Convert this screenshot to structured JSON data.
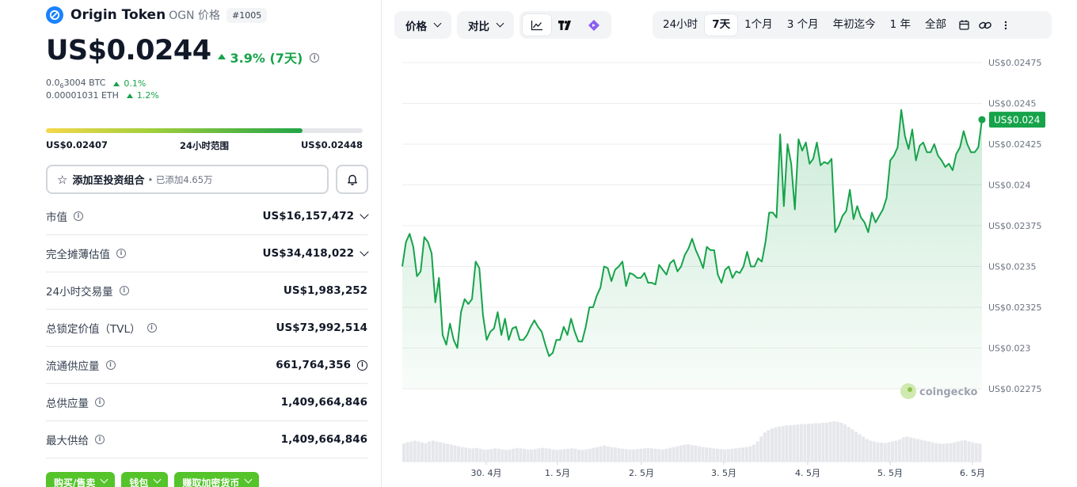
{
  "coin": {
    "name": "Origin Token",
    "symbol_label": "OGN 价格",
    "rank": "#1005",
    "price": "US$0.0244",
    "change": "3.9% (7天)",
    "btc_price_prefix": "0.0",
    "btc_price_sub": "6",
    "btc_price_suffix": "3004 BTC",
    "btc_change": "0.1%",
    "eth_price": "0.00001031 ETH",
    "eth_change": "1.2%"
  },
  "range_24h": {
    "low": "US$0.02407",
    "label": "24小时范围",
    "high": "US$0.02448",
    "position": 0.81
  },
  "portfolio": {
    "button_label": "添加至投资组合",
    "added_text": "• 已添加4.65万"
  },
  "stats": [
    {
      "label": "市值",
      "value": "US$16,157,472",
      "chevron": true,
      "value_info": false
    },
    {
      "label": "完全摊薄估值",
      "value": "US$34,418,022",
      "chevron": true,
      "value_info": false
    },
    {
      "label": "24小时交易量",
      "value": "US$1,983,252",
      "chevron": false,
      "value_info": false
    },
    {
      "label": "总锁定价值（TVL）",
      "value": "US$73,992,514",
      "chevron": false,
      "value_info": false
    },
    {
      "label": "流通供应量",
      "value": "661,764,356",
      "chevron": false,
      "value_info": true
    },
    {
      "label": "总供应量",
      "value": "1,409,664,846",
      "chevron": false,
      "value_info": false
    },
    {
      "label": "最大供给",
      "value": "1,409,664,846",
      "chevron": false,
      "value_info": false
    }
  ],
  "actions": {
    "buy_sell": "购买/售卖",
    "wallet": "钱包",
    "earn": "赚取加密货币"
  },
  "toolbar": {
    "price_dropdown": "价格",
    "compare_dropdown": "对比",
    "ranges": [
      "24小时",
      "7天",
      "1个月",
      "3 个月",
      "年初迄今",
      "1 年",
      "全部"
    ],
    "active_range": "7天"
  },
  "colors": {
    "up_green": "#16a34a",
    "line_green": "#16a34a",
    "brand_blue": "#1a82ff"
  },
  "chart_data": {
    "type": "area",
    "y_tick_labels": [
      "US$0.02475",
      "US$0.0245",
      "US$0.02425",
      "US$0.024",
      "US$0.02375",
      "US$0.0235",
      "US$0.02325",
      "US$0.023",
      "US$0.02275"
    ],
    "y_ticks": [
      0.02475,
      0.0245,
      0.02425,
      0.024,
      0.02375,
      0.0235,
      0.02325,
      0.023,
      0.02275
    ],
    "ylim": [
      0.02275,
      0.02475
    ],
    "x_tick_labels": [
      "30. 4月",
      "1. 5月",
      "2. 5月",
      "3. 5月",
      "4. 5月",
      "5. 5月",
      "6. 5月"
    ],
    "current_label": "US$0.024",
    "watermark": "coingecko",
    "values": [
      0.0235,
      0.02365,
      0.0237,
      0.02362,
      0.02344,
      0.02347,
      0.02368,
      0.02365,
      0.02358,
      0.02328,
      0.02343,
      0.02308,
      0.02302,
      0.02315,
      0.02305,
      0.023,
      0.02322,
      0.0233,
      0.02327,
      0.0233,
      0.02353,
      0.02349,
      0.0232,
      0.02305,
      0.0231,
      0.02312,
      0.02322,
      0.02308,
      0.02318,
      0.02305,
      0.02312,
      0.02313,
      0.02305,
      0.02305,
      0.02308,
      0.02313,
      0.02317,
      0.02313,
      0.0231,
      0.02302,
      0.02295,
      0.02297,
      0.02305,
      0.02305,
      0.02313,
      0.02308,
      0.02318,
      0.0231,
      0.02304,
      0.02304,
      0.02313,
      0.02325,
      0.02325,
      0.02332,
      0.02337,
      0.0235,
      0.02349,
      0.02341,
      0.02348,
      0.0235,
      0.02353,
      0.02338,
      0.02346,
      0.02345,
      0.02343,
      0.02343,
      0.02346,
      0.0234,
      0.0234,
      0.02339,
      0.02351,
      0.02348,
      0.02345,
      0.02352,
      0.02354,
      0.02347,
      0.0235,
      0.02357,
      0.02361,
      0.02367,
      0.0236,
      0.02355,
      0.02349,
      0.02362,
      0.0236,
      0.0236,
      0.02345,
      0.0234,
      0.02348,
      0.0235,
      0.02343,
      0.02347,
      0.02346,
      0.0235,
      0.02359,
      0.0235,
      0.0235,
      0.02355,
      0.02353,
      0.02365,
      0.02383,
      0.02383,
      0.0238,
      0.02431,
      0.02387,
      0.02425,
      0.02413,
      0.02385,
      0.02428,
      0.02421,
      0.02426,
      0.02413,
      0.02416,
      0.02426,
      0.02412,
      0.02414,
      0.02413,
      0.02416,
      0.02371,
      0.02375,
      0.02381,
      0.02384,
      0.02397,
      0.02379,
      0.02387,
      0.0238,
      0.02377,
      0.02371,
      0.02383,
      0.02377,
      0.02381,
      0.02385,
      0.02392,
      0.02415,
      0.02418,
      0.02423,
      0.02446,
      0.0243,
      0.02422,
      0.02434,
      0.02415,
      0.02424,
      0.02426,
      0.0242,
      0.0242,
      0.02425,
      0.02418,
      0.02415,
      0.02411,
      0.02413,
      0.02409,
      0.02419,
      0.02423,
      0.02433,
      0.02425,
      0.0242,
      0.0242,
      0.02423,
      0.0244
    ],
    "volume": [
      0.45,
      0.48,
      0.5,
      0.52,
      0.5,
      0.47,
      0.46,
      0.5,
      0.52,
      0.5,
      0.48,
      0.46,
      0.44,
      0.42,
      0.4,
      0.38,
      0.36,
      0.35,
      0.33,
      0.33,
      0.34,
      0.32,
      0.3,
      0.3,
      0.31,
      0.33,
      0.32,
      0.3,
      0.29,
      0.3,
      0.32,
      0.34,
      0.33,
      0.32,
      0.3,
      0.3,
      0.31,
      0.33,
      0.34,
      0.33,
      0.32,
      0.3,
      0.29,
      0.3,
      0.31,
      0.32,
      0.33,
      0.32,
      0.3,
      0.29,
      0.3,
      0.32,
      0.34,
      0.36,
      0.38,
      0.4,
      0.38,
      0.36,
      0.35,
      0.33,
      0.32,
      0.31,
      0.3,
      0.3,
      0.31,
      0.32,
      0.33,
      0.34,
      0.33,
      0.32,
      0.31,
      0.3,
      0.32,
      0.34,
      0.36,
      0.38,
      0.4,
      0.42,
      0.43,
      0.41,
      0.4,
      0.38,
      0.36,
      0.35,
      0.34,
      0.33,
      0.32,
      0.31,
      0.3,
      0.31,
      0.32,
      0.33,
      0.34,
      0.35,
      0.36,
      0.38,
      0.42,
      0.5,
      0.62,
      0.72,
      0.78,
      0.82,
      0.85,
      0.87,
      0.88,
      0.9,
      0.9,
      0.91,
      0.92,
      0.93,
      0.93,
      0.94,
      0.94,
      0.95,
      0.95,
      0.96,
      0.97,
      0.98,
      1.0,
      0.99,
      0.96,
      0.92,
      0.86,
      0.8,
      0.74,
      0.68,
      0.62,
      0.56,
      0.52,
      0.5,
      0.48,
      0.47,
      0.46,
      0.48,
      0.5,
      0.52,
      0.55,
      0.6,
      0.62,
      0.6,
      0.58,
      0.56,
      0.54,
      0.52,
      0.5,
      0.48,
      0.46,
      0.45,
      0.44,
      0.45,
      0.46,
      0.48,
      0.5,
      0.52,
      0.53,
      0.5,
      0.48,
      0.46,
      0.45
    ]
  }
}
